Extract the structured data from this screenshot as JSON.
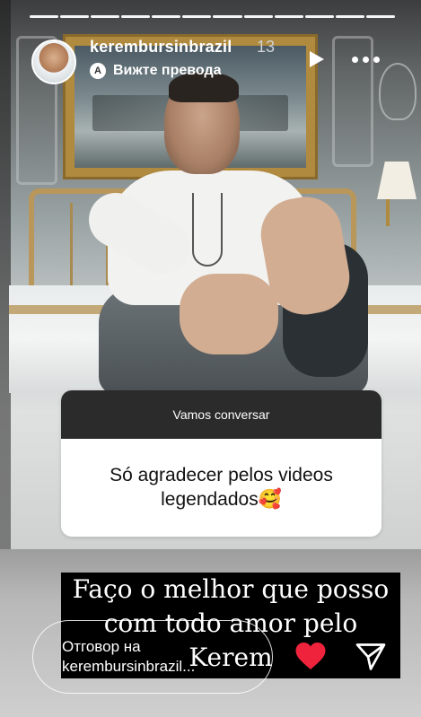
{
  "story": {
    "segments_count": 12,
    "username": "kerembursinbrazil",
    "time": "13",
    "translate_label": "Вижте превода",
    "translate_glyph": "A"
  },
  "question": {
    "header": "Vamos conversar",
    "answer": "Só agradecer pelos videos legendados🥰"
  },
  "caption": {
    "line1": "Faço o melhor que posso",
    "line2": "com todo amor  pelo",
    "line3": "Kerem"
  },
  "reply": {
    "line1": "Отговор на",
    "line2": "kerembursinbrazil..."
  },
  "colors": {
    "heart": "#f0233d",
    "question_header_bg": "#2b2b2b"
  }
}
